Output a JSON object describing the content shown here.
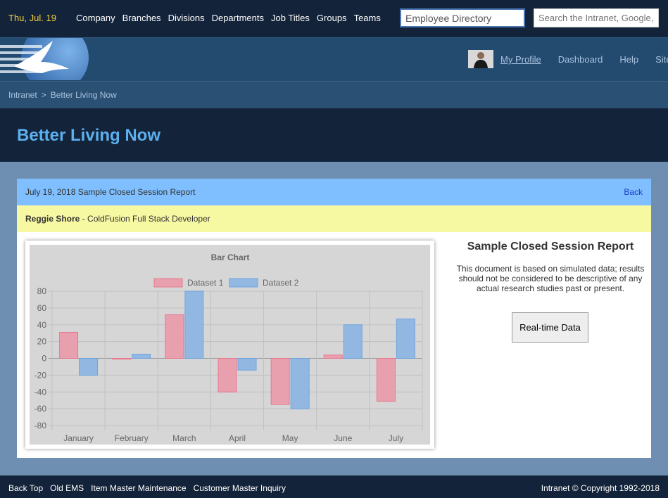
{
  "topnav": {
    "date": "Thu, Jul. 19",
    "links": [
      "Company",
      "Branches",
      "Divisions",
      "Departments",
      "Job Titles",
      "Groups",
      "Teams"
    ],
    "employee_directory_value": "Employee Directory",
    "search_placeholder": "Search the Intranet, Google, or"
  },
  "usernav": {
    "links": [
      "My Profile",
      "Dashboard",
      "Help",
      "Site M"
    ]
  },
  "breadcrumb": [
    "Intranet",
    "Better Living Now"
  ],
  "page_title": "Better Living Now",
  "card": {
    "header_title": "July 19, 2018 Sample Closed Session Report",
    "back_label": "Back",
    "person_name": "Reggie Shore",
    "person_role": " - ColdFusion Full Stack Developer",
    "report_title": "Sample Closed Session Report",
    "report_description": "This document is based on simulated data; results should not be considered to be descriptive of any actual research studies past or present.",
    "button_label": "Real-time Data"
  },
  "chart_data": {
    "type": "bar",
    "title": "Bar Chart",
    "categories": [
      "January",
      "February",
      "March",
      "April",
      "May",
      "June",
      "July"
    ],
    "series": [
      {
        "name": "Dataset 1",
        "values": [
          31,
          -1,
          52,
          -40,
          -55,
          4,
          -51
        ],
        "fill": "#e8a0ae",
        "stroke": "#e8798f"
      },
      {
        "name": "Dataset 2",
        "values": [
          -20,
          5,
          80,
          -14,
          -60,
          40,
          47
        ],
        "fill": "#92b8e2",
        "stroke": "#6fa4de"
      }
    ],
    "ylim": [
      -80,
      80
    ],
    "yticks": [
      80,
      60,
      40,
      20,
      0,
      -20,
      -40,
      -60,
      -80
    ],
    "grid": true,
    "legend": "top"
  },
  "footer": {
    "links": [
      "Back Top",
      "Old EMS",
      "Item Master Maintenance",
      "Customer Master Inquiry"
    ],
    "copyright": "Intranet © Copyright 1992-2018"
  }
}
